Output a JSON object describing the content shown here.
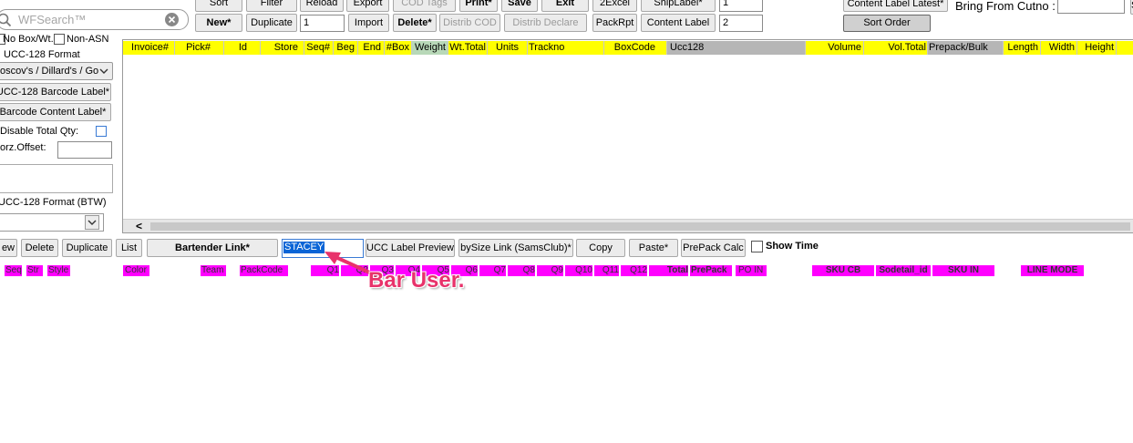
{
  "search": {
    "placeholder": "WFSearch™"
  },
  "toolbar_top": {
    "sort": "Sort",
    "filter": "Filter",
    "reload": "Reload",
    "export": "Export",
    "cod_tags": "COD Tags",
    "print": "Print*",
    "save": "Save",
    "exit": "Exit",
    "to_excel": "2Excel",
    "ship_label": "ShipLabel*",
    "ship_label_value": "1"
  },
  "toolbar_second": {
    "new": "New*",
    "duplicate": "Duplicate",
    "copies_value": "1",
    "import": "Import",
    "delete": "Delete*",
    "distrib_cod": "Distrib COD",
    "distrib_declare": "Distrib Declare",
    "pack_rpt": "PackRpt",
    "content_label": "Content Label",
    "content_label_value": "2"
  },
  "right_top": {
    "content_label_latest": "Content Label Latest*",
    "bring_from_cutno": "Bring From Cutno :",
    "bring_from_value": "",
    "sort_order": "Sort Order"
  },
  "left_panel": {
    "no_box_wt": "No Box/Wt.",
    "non_asn": "Non-ASN",
    "ucc_format": "UCC-128 Format",
    "customer_select": "oscov's / Dillard's / Go",
    "ucc_barcode_label": "UCC-128 Barcode Label*",
    "barcode_content_label": "Barcode Content Label*",
    "disable_total_qty": "Disable Total Qty:",
    "horz_offset": "orz.Offset:",
    "horz_offset_value": "",
    "ucc_format_btw": "UCC-128 Format (BTW)",
    "btw_select": ""
  },
  "upper_grid": {
    "columns": [
      "Invoice#",
      "Pick#",
      "Id",
      "Store",
      "Seq#",
      "Beg",
      "End",
      "#Box",
      "Weight",
      "Wt.Total",
      "Units",
      "Trackno",
      "BoxCode",
      "Ucc128",
      "Volume",
      "Vol.Total",
      "Prepack/Bulk",
      "Length",
      "Width",
      "Height"
    ],
    "scroll_left": "<"
  },
  "bottom_toolbar": {
    "new": "ew",
    "delete": "Delete",
    "duplicate": "Duplicate",
    "list": "List",
    "bartender_link": "Bartender Link*",
    "bar_user_value": "STACEY",
    "ucc_label_preview": "UCC Label Preview",
    "bysize_link": "bySize Link (SamsClub)*",
    "copy": "Copy",
    "paste": "Paste*",
    "prepack_calc": "PrePack Calc",
    "show_time": "Show Time"
  },
  "lower_grid": {
    "columns": [
      "Seq",
      "Str",
      "Style",
      "Color",
      "Team",
      "PackCode",
      "Q1",
      "Q2",
      "Q3",
      "Q4",
      "Q5",
      "Q6",
      "Q7",
      "Q8",
      "Q9",
      "Q10",
      "Q11",
      "Q12",
      "Total",
      "PrePack",
      "PO IN",
      "SKU CB",
      "Sodetail_id",
      "SKU IN",
      "LINE MODE"
    ]
  },
  "annotation": {
    "text": "Bar User."
  },
  "colors": {
    "header_yellow": "#ffff00",
    "header_magenta": "#ff00ff",
    "annotation": "#e8336b",
    "selection_blue": "#0a64d6"
  }
}
